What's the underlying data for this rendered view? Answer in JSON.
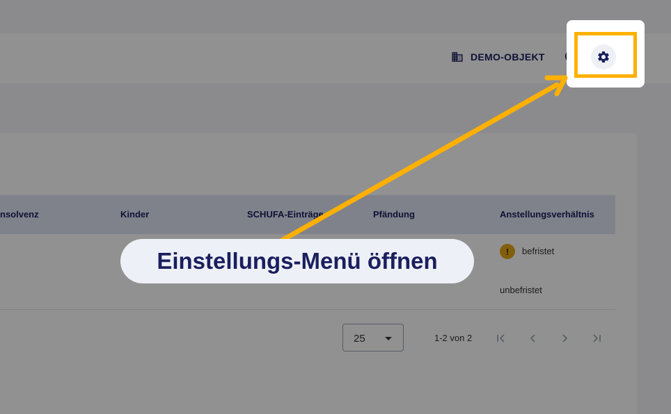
{
  "header": {
    "project_label": "DEMO-OBJEKT",
    "help_glyph": "?",
    "icons": {
      "project": "building-icon",
      "help": "help-circle-icon",
      "settings": "gear-icon"
    }
  },
  "table": {
    "columns": [
      "nsolvenz",
      "Kinder",
      "SCHUFA-Einträge",
      "Pfändung",
      "Anstellungsverhältnis"
    ],
    "rows": [
      {
        "anstellung": "befristet",
        "warning_glyph": "!"
      },
      {
        "anstellung": "unbefristet"
      }
    ]
  },
  "pagination": {
    "page_size": "25",
    "range_label": "1-2 von 2",
    "icons": [
      "first-page-icon",
      "prev-page-icon",
      "next-page-icon",
      "last-page-icon"
    ]
  },
  "tutorial": {
    "callout_text": "Einstellungs-Menü öffnen",
    "highlight_color": "#ffb000"
  }
}
